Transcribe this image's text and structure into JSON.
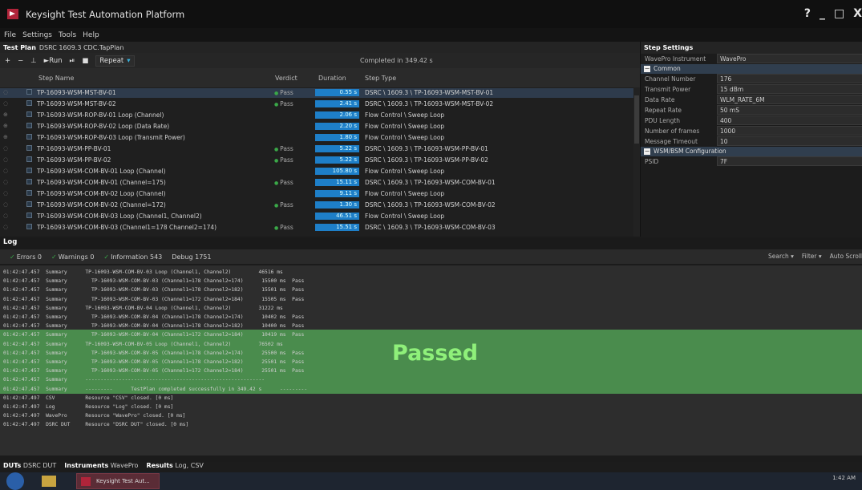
{
  "window": {
    "title": "Keysight Test Automation Platform",
    "controls": [
      "?",
      "_",
      "□",
      "X"
    ]
  },
  "menu": [
    "File",
    "Settings",
    "Tools",
    "Help"
  ],
  "plan": {
    "label": "Test Plan",
    "name": "DSRC 1609.3 CDC.TapPlan"
  },
  "toolbar": {
    "add": "+",
    "remove": "−",
    "insert": "⊥",
    "run": "►Run",
    "pause": "⏯",
    "stop": "■",
    "repeat": "Repeat",
    "status": "Completed in 349.42 s"
  },
  "grid": {
    "headers": [
      "Step Name",
      "Verdict",
      "Duration",
      "Step Type"
    ],
    "rows": [
      {
        "name": "TP-16093-WSM-MST-BV-01",
        "verdict": "Pass",
        "duration": "0.55 s",
        "type": "DSRC \\ 1609.3 \\ TP-16093-WSM-MST-BV-01",
        "tree": "◌"
      },
      {
        "name": "TP-16093-WSM-MST-BV-02",
        "verdict": "Pass",
        "duration": "2.41 s",
        "type": "DSRC \\ 1609.3 \\ TP-16093-WSM-MST-BV-02",
        "tree": "◌"
      },
      {
        "name": "TP-16093-WSM-ROP-BV-01 Loop (Channel)",
        "verdict": "",
        "duration": "2.06 s",
        "type": "Flow Control \\ Sweep Loop",
        "tree": "⊕"
      },
      {
        "name": "TP-16093-WSM-ROP-BV-02 Loop (Data Rate)",
        "verdict": "",
        "duration": "2.20 s",
        "type": "Flow Control \\ Sweep Loop",
        "tree": "⊕"
      },
      {
        "name": "TP-16093-WSM-ROP-BV-03 Loop (Transmit Power)",
        "verdict": "",
        "duration": "1.80 s",
        "type": "Flow Control \\ Sweep Loop",
        "tree": "⊕"
      },
      {
        "name": "TP-16093-WSM-PP-BV-01",
        "verdict": "Pass",
        "duration": "5.22 s",
        "type": "DSRC \\ 1609.3 \\ TP-16093-WSM-PP-BV-01",
        "tree": "◌"
      },
      {
        "name": "TP-16093-WSM-PP-BV-02",
        "verdict": "Pass",
        "duration": "5.22 s",
        "type": "DSRC \\ 1609.3 \\ TP-16093-WSM-PP-BV-02",
        "tree": "◌"
      },
      {
        "name": "TP-16093-WSM-COM-BV-01 Loop (Channel)",
        "verdict": "",
        "duration": "105.80 s",
        "type": "Flow Control \\ Sweep Loop",
        "tree": "◌"
      },
      {
        "name": "TP-16093-WSM-COM-BV-01 (Channel=175)",
        "verdict": "Pass",
        "duration": "15.11 s",
        "type": "DSRC \\ 1609.3 \\ TP-16093-WSM-COM-BV-01",
        "tree": "◌"
      },
      {
        "name": "TP-16093-WSM-COM-BV-02 Loop (Channel)",
        "verdict": "",
        "duration": "9.11 s",
        "type": "Flow Control \\ Sweep Loop",
        "tree": "◌"
      },
      {
        "name": "TP-16093-WSM-COM-BV-02 (Channel=172)",
        "verdict": "Pass",
        "duration": "1.30 s",
        "type": "DSRC \\ 1609.3 \\ TP-16093-WSM-COM-BV-02",
        "tree": "◌"
      },
      {
        "name": "TP-16093-WSM-COM-BV-03 Loop (Channel1, Channel2)",
        "verdict": "",
        "duration": "46.51 s",
        "type": "Flow Control \\ Sweep Loop",
        "tree": "◌"
      },
      {
        "name": "TP-16093-WSM-COM-BV-03 (Channel1=178 Channel2=174)",
        "verdict": "Pass",
        "duration": "15.51 s",
        "type": "DSRC \\ 1609.3 \\ TP-16093-WSM-COM-BV-03",
        "tree": "◌"
      }
    ]
  },
  "settings": {
    "title": "Step Settings",
    "instrument": {
      "label": "WavePro Instrument",
      "value": "WavePro"
    },
    "common": "Common",
    "fields": [
      {
        "k": "Channel Number",
        "v": "176"
      },
      {
        "k": "Transmit Power",
        "v": "15 dBm"
      },
      {
        "k": "Data Rate",
        "v": "WLM_RATE_6M"
      },
      {
        "k": "Repeat Rate",
        "v": "50 mS"
      },
      {
        "k": "PDU Length",
        "v": "400"
      },
      {
        "k": "Number of frames",
        "v": "1000"
      },
      {
        "k": "Message Timeout",
        "v": "10"
      }
    ],
    "wsm": "WSM/BSM Configuration",
    "psid": {
      "k": "PSID",
      "v": "7F"
    }
  },
  "log": {
    "title": "Log",
    "filters": [
      "Errors 0",
      "Warnings 0",
      "Information 543",
      "Debug 1751"
    ],
    "right": [
      "Search ▾",
      "Filter ▾",
      "Auto Scroll"
    ],
    "lines": [
      "01:42:47.457  Summary      TP-16093-WSM-COM-BV-03 Loop (Channel1, Channel2)         46516 ms",
      "01:42:47.457  Summary        TP-16093-WSM-COM-BV-03 (Channel1=178 Channel2=174)      15500 ms  Pass",
      "01:42:47.457  Summary        TP-16093-WSM-COM-BV-03 (Channel1=178 Channel2=182)      15501 ms  Pass",
      "01:42:47.457  Summary        TP-16093-WSM-COM-BV-03 (Channel1=172 Channel2=184)      15505 ms  Pass",
      "01:42:47.457  Summary      TP-16093-WSM-COM-BV-04 Loop (Channel1, Channel2)         31222 ms",
      "01:42:47.457  Summary        TP-16093-WSM-COM-BV-04 (Channel1=178 Channel2=174)      10402 ms  Pass",
      "01:42:47.457  Summary        TP-16093-WSM-COM-BV-04 (Channel1=178 Channel2=182)      10400 ms  Pass",
      "01:42:47.457  Summary        TP-16093-WSM-COM-BV-04 (Channel1=172 Channel2=184)      10419 ms  Pass",
      "01:42:47.457  Summary      TP-16093-WSM-COM-BV-05 Loop (Channel1, Channel2)         76502 ms",
      "01:42:47.457  Summary        TP-16093-WSM-COM-BV-05 (Channel1=178 Channel2=174)      25500 ms  Pass",
      "01:42:47.457  Summary        TP-16093-WSM-COM-BV-05 (Channel1=178 Channel2=182)      25501 ms  Pass",
      "01:42:47.457  Summary        TP-16093-WSM-COM-BV-05 (Channel1=172 Channel2=184)      25501 ms  Pass",
      "01:42:47.457  Summary      -----------------------------------------------------------",
      "01:42:47.457  Summary      ---------      TestPlan completed successfully in 349.42 s      ---------",
      "01:42:47.497  CSV          Resource \"CSV\" closed. [0 ms]",
      "01:42:47.497  Log          Resource \"Log\" closed. [0 ms]",
      "01:42:47.497  WavePro      Resource \"WavePro\" closed. [0 ms]",
      "01:42:47.497  DSRC DUT     Resource \"DSRC DUT\" closed. [0 ms]"
    ],
    "passed": "Passed"
  },
  "bottom_tabs": {
    "duts_label": "DUTs",
    "duts": "DSRC DUT",
    "instr_label": "Instruments",
    "instr": "WavePro",
    "results_label": "Results",
    "results": "Log, CSV"
  },
  "taskbar": {
    "app": "Keysight Test Aut...",
    "time": "1:42 AM"
  }
}
